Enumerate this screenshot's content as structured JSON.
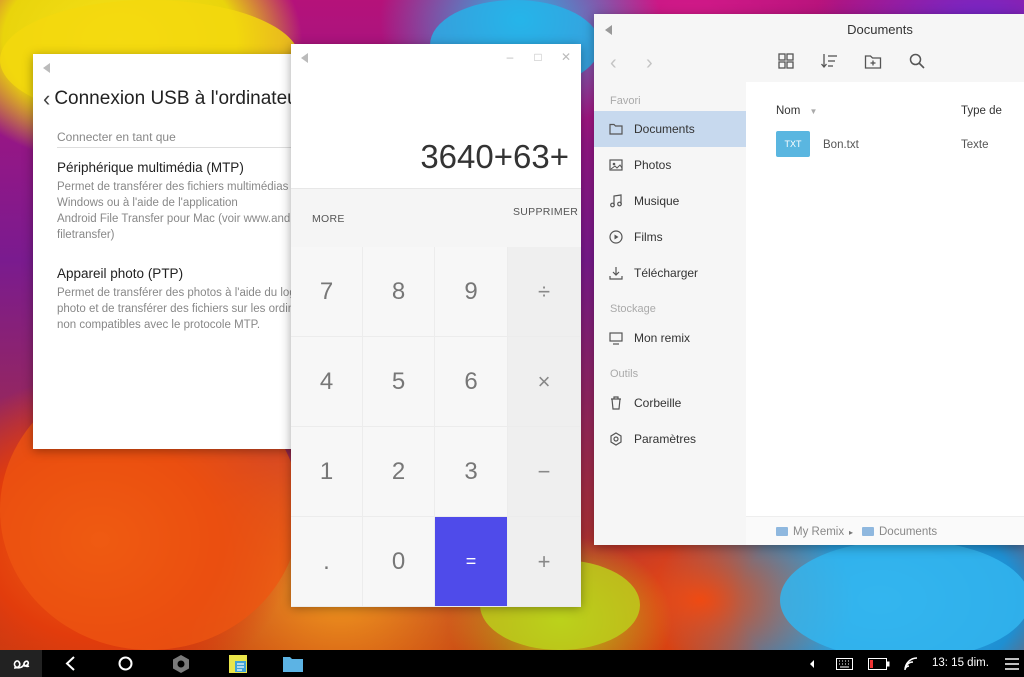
{
  "usb_settings": {
    "title": "Connexion USB à l'ordinateur",
    "section": "Connecter en tant que",
    "options": [
      {
        "title": "Périphérique multimédia (MTP)",
        "desc": [
          "Permet de transférer des fichiers multimédias",
          "Windows ou à l'aide de l'application",
          "Android File Transfer pour Mac (voir www.android.com/",
          "filetransfer)"
        ]
      },
      {
        "title": "Appareil photo (PTP)",
        "desc": [
          "Permet de transférer des photos à l'aide du logiciel",
          "photo et de transférer des fichiers sur les ordinateurs",
          "non compatibles avec le protocole MTP."
        ]
      }
    ]
  },
  "calculator": {
    "display": "3640+63+",
    "more_label": "MORE",
    "delete_label": "SUPPRIMER",
    "keys": [
      "7",
      "8",
      "9",
      "÷",
      "4",
      "5",
      "6",
      "×",
      "1",
      "2",
      "3",
      "−",
      ".",
      "0",
      "=",
      "+"
    ]
  },
  "file_manager": {
    "title": "Documents",
    "sections": {
      "favorites": "Favori",
      "storage": "Stockage",
      "tools": "Outils"
    },
    "favorites": [
      "Documents",
      "Photos",
      "Musique",
      "Films",
      "Télécharger"
    ],
    "storage": [
      "Mon remix"
    ],
    "tools": [
      "Corbeille",
      "Paramètres"
    ],
    "columns": {
      "name": "Nom",
      "type": "Type de"
    },
    "files": [
      {
        "icon_label": "TXT",
        "name": "Bon.txt",
        "type": "Texte"
      }
    ],
    "breadcrumb": [
      "My Remix",
      "Documents"
    ]
  },
  "taskbar": {
    "clock": "13: 15 dim."
  },
  "colors": {
    "accent_equals": "#4f4bea",
    "sidebar_active": "#c7d9ee",
    "file_icon": "#5ab6e0"
  }
}
